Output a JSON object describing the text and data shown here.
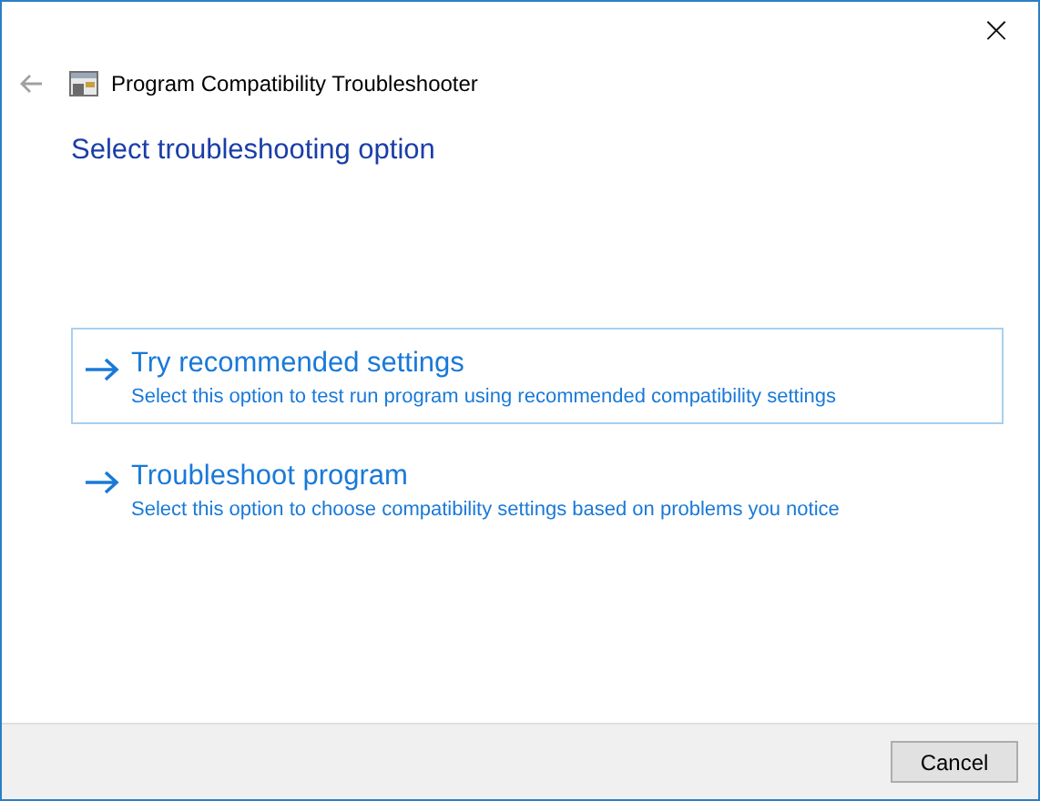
{
  "window": {
    "title": "Program Compatibility Troubleshooter",
    "close": "×"
  },
  "heading": "Select troubleshooting option",
  "options": [
    {
      "title": "Try recommended settings",
      "description": "Select this option to test run program using recommended compatibility settings",
      "selected": true
    },
    {
      "title": "Troubleshoot program",
      "description": "Select this option to choose compatibility settings based on problems you notice",
      "selected": false
    }
  ],
  "buttons": [
    "Cancel"
  ]
}
